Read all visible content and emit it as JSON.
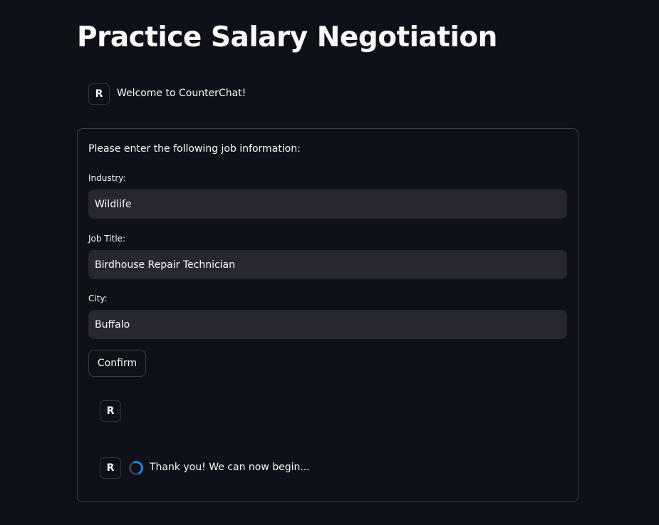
{
  "page": {
    "title": "Practice Salary Negotiation"
  },
  "chat": {
    "welcome": {
      "avatar": "R",
      "text": "Welcome to CounterChat!"
    },
    "form": {
      "heading": "Please enter the following job information:",
      "fields": [
        {
          "label": "Industry:",
          "value": "Wildlife"
        },
        {
          "label": "Job Title:",
          "value": "Birdhouse Repair Technician"
        },
        {
          "label": "City:",
          "value": "Buffalo"
        }
      ],
      "confirm_label": "Confirm"
    },
    "empty_message": {
      "avatar": "R"
    },
    "loading_message": {
      "avatar": "R",
      "text": "Thank you! We can now begin...",
      "icon": "loading-spinner-icon"
    }
  },
  "colors": {
    "background": "#0e1117",
    "input_background": "#262730",
    "border": "#3b3e46",
    "spinner_accent": "#1c83e1",
    "text": "#fafafa"
  }
}
